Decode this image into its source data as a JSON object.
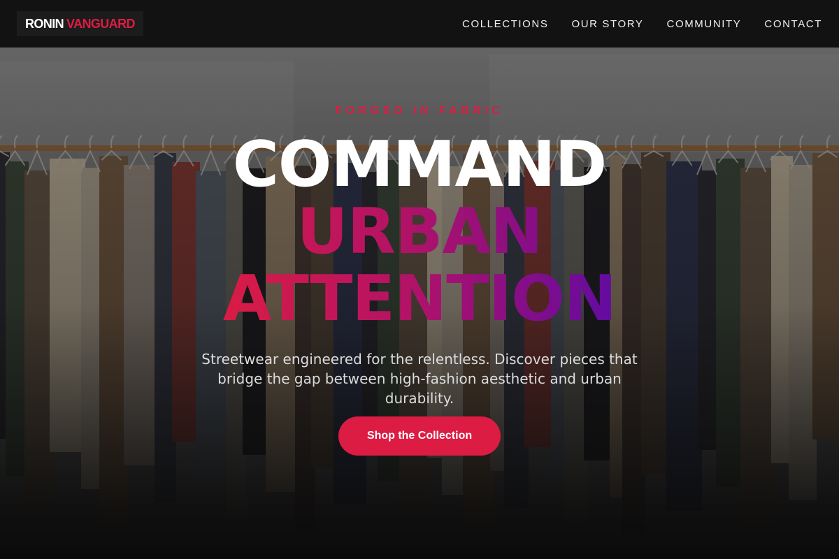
{
  "brand": {
    "word1": "RONIN",
    "word2": "VANGUARD",
    "accent": "#dc1c43"
  },
  "nav": [
    {
      "label": "COLLECTIONS"
    },
    {
      "label": "OUR STORY"
    },
    {
      "label": "COMMUNITY"
    },
    {
      "label": "CONTACT"
    }
  ],
  "hero": {
    "eyebrow": "FORGED IN FABRIC",
    "line1": "COMMAND",
    "line2": "URBAN",
    "line3": "ATTENTION",
    "subtext": "Streetwear engineered for the relentless. Discover pieces that bridge the gap between high-fashion aesthetic and urban durability.",
    "cta_label": "Shop the Collection",
    "background": "clothing-rack-photo",
    "gradient_start": "#dc1c43",
    "gradient_end": "#5b0aa6"
  }
}
